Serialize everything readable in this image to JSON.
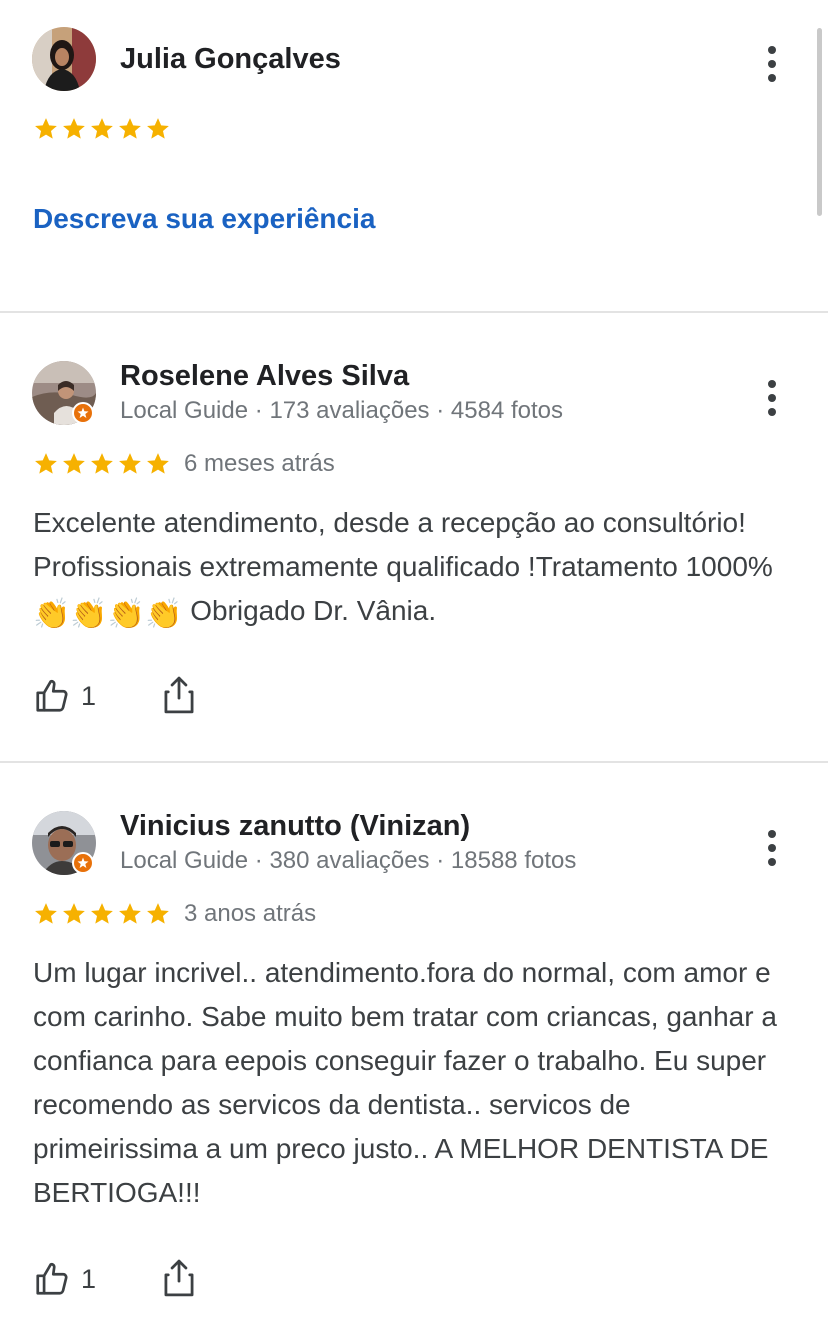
{
  "user_review": {
    "name": "Julia Gonçalves",
    "rating": 5,
    "prompt_link": "Descreva sua experiência"
  },
  "reviews": [
    {
      "name": "Roselene Alves Silva",
      "badge": "Local Guide",
      "reviews_count": "173 avaliações",
      "photos_count": "4584 fotos",
      "rating": 5,
      "when": "6 meses atrás",
      "text_before_emoji": "Excelente atendimento, desde a recepção ao consultório! Profissionais extremamente qualificado !Tratamento 1000%",
      "emoji": "👏👏👏👏",
      "text_after_emoji": "Obrigado Dr. Vânia.",
      "likes": "1"
    },
    {
      "name": "Vinicius zanutto (Vinizan)",
      "badge": "Local Guide",
      "reviews_count": "380 avaliações",
      "photos_count": "18588 fotos",
      "rating": 5,
      "when": "3 anos atrás",
      "text": "Um lugar incrivel.. atendimento.fora do normal, com amor e com carinho. Sabe muito bem tratar com criancas, ganhar a confianca para eepois conseguir fazer o trabalho. Eu super recomendo as servicos da dentista.. servicos de primeirissima a um preco justo.. A MELHOR DENTISTA DE BERTIOGA!!!",
      "likes": "1"
    }
  ],
  "meta_separator": "·",
  "colors": {
    "star": "#f6b100",
    "link": "#1a62c2",
    "guide_badge": "#e8710a"
  },
  "icons": [
    "more-vert-icon",
    "star-icon",
    "local-guide-icon",
    "thumbs-up-icon",
    "share-icon"
  ]
}
